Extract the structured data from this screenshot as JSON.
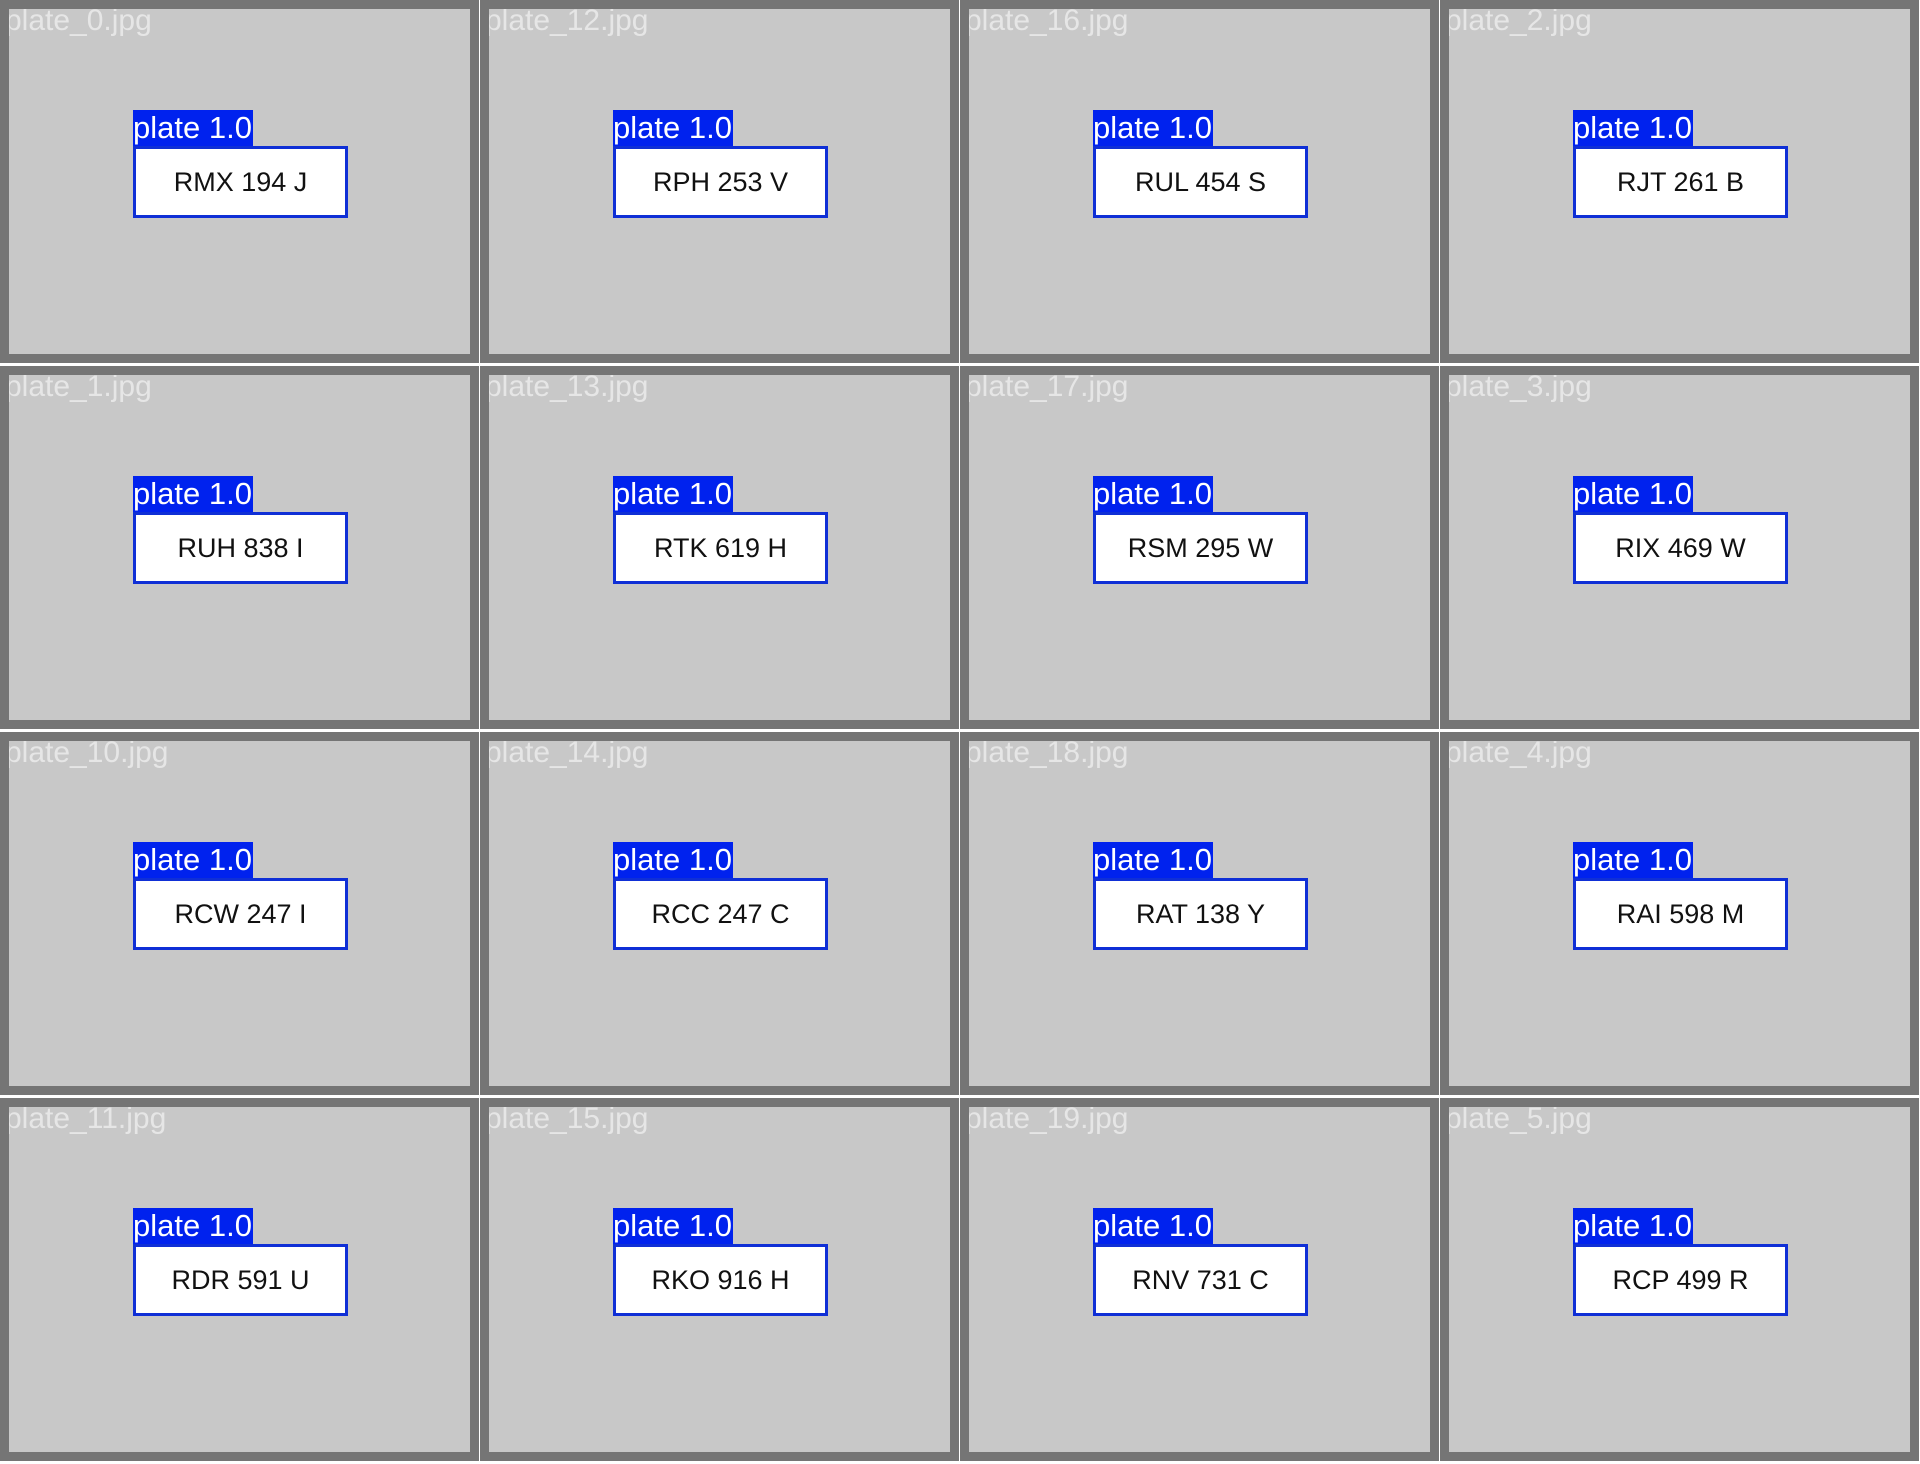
{
  "detection_label": "plate 1.0",
  "colors": {
    "tile_background": "#c8c8c8",
    "tile_border": "#757575",
    "label_background": "#0022ee",
    "box_border": "#0f2fd6"
  },
  "tiles": [
    {
      "filename": "plate_0.jpg",
      "plate_text": "RMX 194 J"
    },
    {
      "filename": "plate_12.jpg",
      "plate_text": "RPH 253 V"
    },
    {
      "filename": "plate_16.jpg",
      "plate_text": "RUL 454 S"
    },
    {
      "filename": "plate_2.jpg",
      "plate_text": "RJT 261 B"
    },
    {
      "filename": "plate_1.jpg",
      "plate_text": "RUH 838 I"
    },
    {
      "filename": "plate_13.jpg",
      "plate_text": "RTK 619 H"
    },
    {
      "filename": "plate_17.jpg",
      "plate_text": "RSM 295 W"
    },
    {
      "filename": "plate_3.jpg",
      "plate_text": "RIX 469 W"
    },
    {
      "filename": "plate_10.jpg",
      "plate_text": "RCW 247 I"
    },
    {
      "filename": "plate_14.jpg",
      "plate_text": "RCC 247 C"
    },
    {
      "filename": "plate_18.jpg",
      "plate_text": "RAT 138 Y"
    },
    {
      "filename": "plate_4.jpg",
      "plate_text": "RAI 598 M"
    },
    {
      "filename": "plate_11.jpg",
      "plate_text": "RDR 591 U"
    },
    {
      "filename": "plate_15.jpg",
      "plate_text": "RKO 916 H"
    },
    {
      "filename": "plate_19.jpg",
      "plate_text": "RNV 731 C"
    },
    {
      "filename": "plate_5.jpg",
      "plate_text": "RCP 499 R"
    }
  ]
}
